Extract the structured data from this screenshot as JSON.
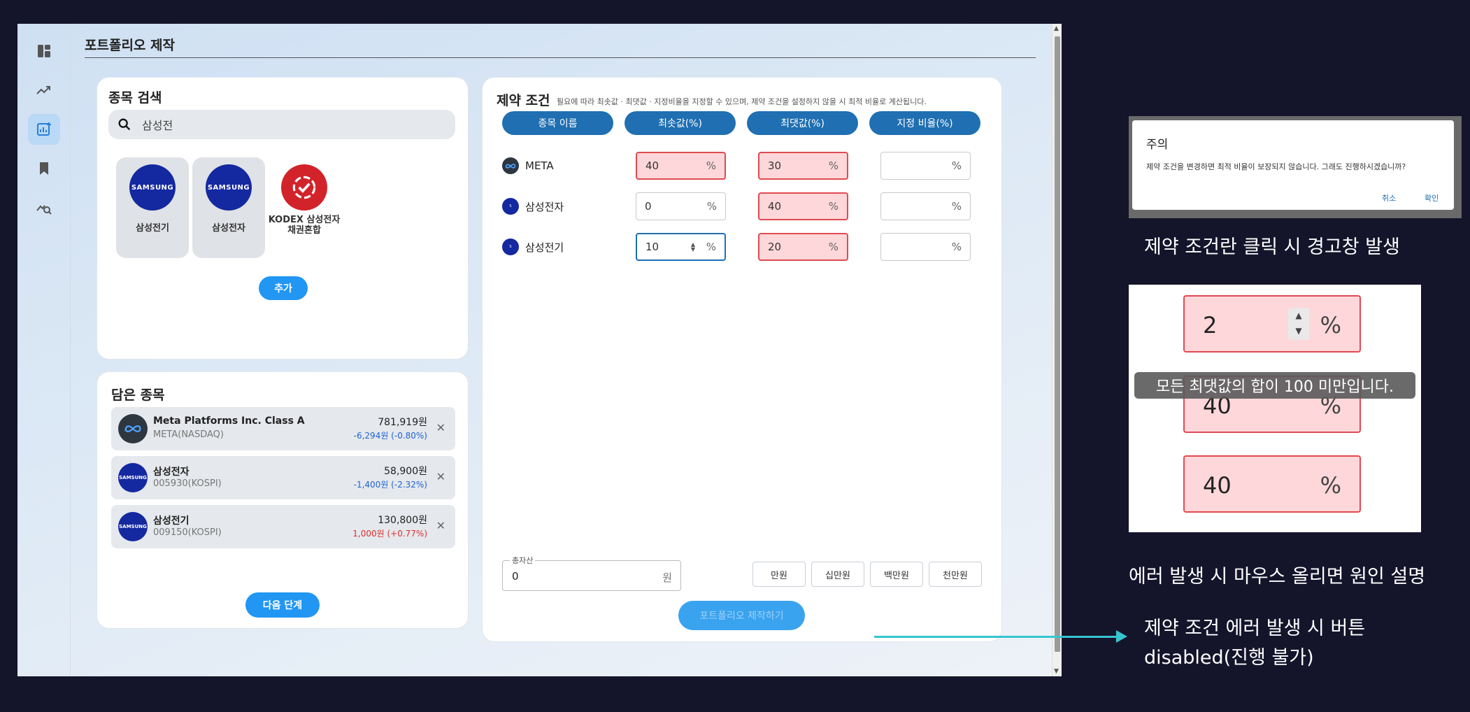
{
  "app": {
    "page_title": "포트폴리오 제작",
    "sidebar": [
      "dashboard-icon",
      "trend-icon",
      "portfolio-build-icon",
      "bookmark-icon",
      "analysis-icon"
    ]
  },
  "search": {
    "title": "종목 검색",
    "query": "삼성전",
    "results": [
      {
        "logo": "SAMSUNG",
        "name": "삼성전기"
      },
      {
        "logo": "SAMSUNG",
        "name": "삼성전자"
      },
      {
        "logo": "",
        "name": "KODEX 삼성전자 채권혼합"
      }
    ],
    "add_label": "추가"
  },
  "holdings": {
    "title": "담은 종목",
    "items": [
      {
        "name": "Meta Platforms Inc. Class A",
        "ticker": "META(NASDAQ)",
        "price": "781,919원",
        "change": "-6,294원 (-0.80%)"
      },
      {
        "name": "삼성전자",
        "ticker": "005930(KOSPI)",
        "price": "58,900원",
        "change": "-1,400원 (-2.32%)"
      },
      {
        "name": "삼성전기",
        "ticker": "009150(KOSPI)",
        "price": "130,800원",
        "change": "1,000원 (+0.77%)"
      }
    ],
    "next_label": "다음 단계"
  },
  "constraints": {
    "title": "제약 조건",
    "note": "필요에 따라 최솟값 · 최댓값 · 지정비율을 지정할 수 있으며, 제약 조건을 설정하지 않을 시 최적 비율로 계산됩니다.",
    "headers": [
      "종목 이름",
      "최솟값(%)",
      "최댓값(%)",
      "지정 비율(%)"
    ],
    "rows": [
      {
        "name": "META",
        "min": "40",
        "max": "30",
        "fixed": ""
      },
      {
        "name": "삼성전자",
        "min": "0",
        "max": "40",
        "fixed": ""
      },
      {
        "name": "삼성전기",
        "min": "10",
        "max": "20",
        "fixed": ""
      }
    ],
    "pct": "%",
    "asset_label": "총자산",
    "asset_value": "0",
    "asset_unit": "원",
    "unit_buttons": [
      "만원",
      "십만원",
      "백만원",
      "천만원"
    ],
    "make_label": "포트폴리오 제작하기"
  },
  "annotations": {
    "dialog_title": "주의",
    "dialog_body": "제약 조건을 변경하면 최적 비율이 보장되지 않습니다. 그래도 진행하시겠습니까?",
    "dialog_cancel": "취소",
    "dialog_ok": "확인",
    "caption1": "제약 조건란 클릭 시 경고창 발생",
    "zoom_values": [
      "2",
      "40",
      "40"
    ],
    "tooltip": "모든 최댓값의 합이 100 미만입니다.",
    "caption2": "에러 발생 시 마우스 올리면 원인 설명",
    "caption3_line1": "제약 조건 에러 발생 시 버튼",
    "caption3_line2": "disabled(진행 불가)"
  },
  "colors": {
    "accent": "#2196f3",
    "header_blue": "#1f6fb2",
    "error_bg": "#fdd7d9",
    "error_border": "#e04a52",
    "arrow": "#36c5cf"
  }
}
